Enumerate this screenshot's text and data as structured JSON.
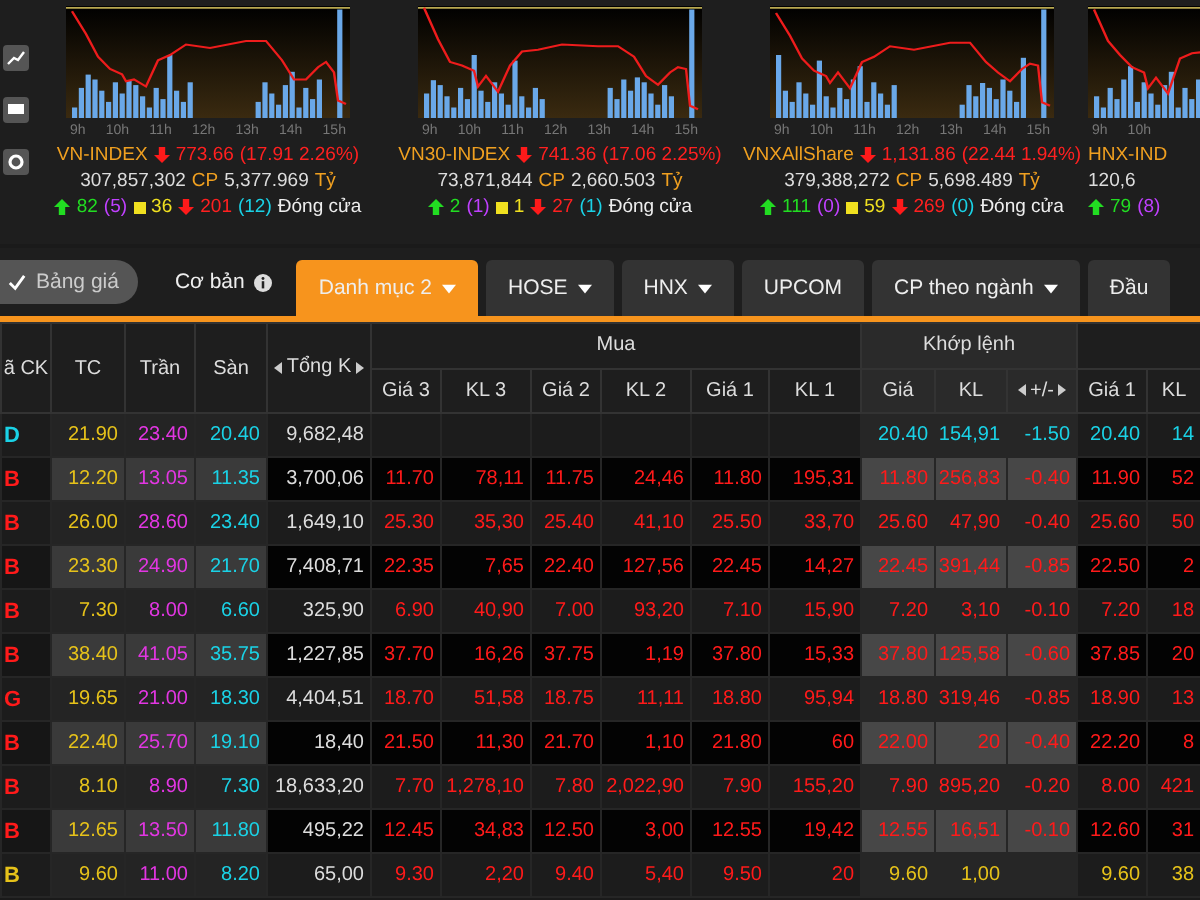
{
  "indices": [
    {
      "name": "VN-INDEX",
      "falling": true,
      "value": "773.66",
      "change": "(17.91 2.26%)",
      "volume": "307,857,302",
      "volume_unit": "CP",
      "value_traded": "5,377.969",
      "value_unit": "Tỷ",
      "advances": "82",
      "ceiling_count": "(5)",
      "unchanged": "36",
      "declines": "201",
      "floor_count": "(12)",
      "session": "Đóng cửa",
      "time_labels": [
        "9h",
        "10h",
        "11h",
        "12h",
        "13h",
        "14h",
        "15h"
      ]
    },
    {
      "name": "VN30-INDEX",
      "falling": true,
      "value": "741.36",
      "change": "(17.06 2.25%)",
      "volume": "73,871,844",
      "volume_unit": "CP",
      "value_traded": "2,660.503",
      "value_unit": "Tỷ",
      "advances": "2",
      "ceiling_count": "(1)",
      "unchanged": "1",
      "declines": "27",
      "floor_count": "(1)",
      "session": "Đóng cửa",
      "time_labels": [
        "9h",
        "10h",
        "11h",
        "12h",
        "13h",
        "14h",
        "15h"
      ]
    },
    {
      "name": "VNXAllShare",
      "falling": true,
      "value": "1,131.86",
      "change": "(22.44 1.94%)",
      "volume": "379,388,272",
      "volume_unit": "CP",
      "value_traded": "5,698.489",
      "value_unit": "Tỷ",
      "advances": "111",
      "ceiling_count": "(0)",
      "unchanged": "59",
      "declines": "269",
      "floor_count": "(0)",
      "session": "Đóng cửa",
      "time_labels": [
        "9h",
        "10h",
        "11h",
        "12h",
        "13h",
        "14h",
        "15h"
      ]
    },
    {
      "name": "HNX-IND",
      "volume": "120,6",
      "advances": "79",
      "ceiling_count": "(8)",
      "time_labels": [
        "9h",
        "10h"
      ]
    }
  ],
  "view_toggle": {
    "label": "Bảng giá",
    "on": true
  },
  "basic_link": {
    "label": "Cơ bản"
  },
  "tabs": [
    {
      "label": "Danh mục 2",
      "dropdown": true,
      "selected": true
    },
    {
      "label": "HOSE",
      "dropdown": true,
      "selected": false
    },
    {
      "label": "HNX",
      "dropdown": true,
      "selected": false
    },
    {
      "label": "UPCOM",
      "dropdown": false,
      "selected": false
    },
    {
      "label": "CP theo ngành",
      "dropdown": true,
      "selected": false
    },
    {
      "label": "Đầu",
      "dropdown": false,
      "selected": false
    }
  ],
  "table": {
    "columns": {
      "symbol": "ã CK",
      "ref": "TC",
      "ceil": "Trần",
      "floor": "Sàn",
      "total": "Tổng K",
      "bid_group": "Mua",
      "match_group": "Khớp lệnh",
      "bid": [
        "Giá 3",
        "KL 3",
        "Giá 2",
        "KL 2",
        "Giá 1",
        "KL 1"
      ],
      "match": [
        "Giá",
        "KL",
        "+/-"
      ],
      "ask": [
        "Giá 1",
        "KL"
      ]
    },
    "rows": [
      {
        "symbol": "D",
        "color": "#1ad2e6",
        "ref": "21.90",
        "ceil": "23.40",
        "floor": "20.40",
        "total": "9,682,48",
        "match": [
          "20.40",
          "154,91",
          "-1.50"
        ],
        "ask": [
          "20.40",
          "14"
        ]
      },
      {
        "symbol": "B",
        "color": "#ff1a1a",
        "ref": "12.20",
        "ceil": "13.05",
        "floor": "11.35",
        "total": "3,700,06",
        "bids": {
          "color": "#ff1a1a",
          "values": [
            "11.70",
            "78,11",
            "11.75",
            "24,46",
            "11.80",
            "195,31"
          ]
        },
        "match": [
          "11.80",
          "256,83",
          "-0.40"
        ],
        "ask": [
          "11.90",
          "52"
        ]
      },
      {
        "symbol": "B",
        "color": "#ff1a1a",
        "ref": "26.00",
        "ceil": "28.60",
        "floor": "23.40",
        "total": "1,649,10",
        "bids": {
          "color": "#ff1a1a",
          "values": [
            "25.30",
            "35,30",
            "25.40",
            "41,10",
            "25.50",
            "33,70"
          ]
        },
        "match": [
          "25.60",
          "47,90",
          "-0.40"
        ],
        "ask": [
          "25.60",
          "50"
        ]
      },
      {
        "symbol": "B",
        "color": "#ff1a1a",
        "ref": "23.30",
        "ceil": "24.90",
        "floor": "21.70",
        "total": "7,408,71",
        "bids": {
          "color": "#ff1a1a",
          "values": [
            "22.35",
            "7,65",
            "22.40",
            "127,56",
            "22.45",
            "14,27"
          ]
        },
        "match": [
          "22.45",
          "391,44",
          "-0.85"
        ],
        "ask": [
          "22.50",
          "2"
        ]
      },
      {
        "symbol": "B",
        "color": "#ff1a1a",
        "ref": "7.30",
        "ceil": "8.00",
        "floor": "6.60",
        "total": "325,90",
        "bids": {
          "color": "#ff1a1a",
          "values": [
            "6.90",
            "40,90",
            "7.00",
            "93,20",
            "7.10",
            "15,90"
          ]
        },
        "match": [
          "7.20",
          "3,10",
          "-0.10"
        ],
        "ask": [
          "7.20",
          "18"
        ]
      },
      {
        "symbol": "B",
        "color": "#ff1a1a",
        "ref": "38.40",
        "ceil": "41.05",
        "floor": "35.75",
        "total": "1,227,85",
        "bids": {
          "color": "#ff1a1a",
          "values": [
            "37.70",
            "16,26",
            "37.75",
            "1,19",
            "37.80",
            "15,33"
          ]
        },
        "match": [
          "37.80",
          "125,58",
          "-0.60"
        ],
        "ask": [
          "37.85",
          "20"
        ]
      },
      {
        "symbol": "G",
        "color": "#ff1a1a",
        "ref": "19.65",
        "ceil": "21.00",
        "floor": "18.30",
        "total": "4,404,51",
        "bids": {
          "color": "#ff1a1a",
          "values": [
            "18.70",
            "51,58",
            "18.75",
            "11,11",
            "18.80",
            "95,94"
          ]
        },
        "match": [
          "18.80",
          "319,46",
          "-0.85"
        ],
        "ask": [
          "18.90",
          "13"
        ]
      },
      {
        "symbol": "B",
        "color": "#ff1a1a",
        "ref": "22.40",
        "ceil": "25.70",
        "floor": "19.10",
        "total": "18,40",
        "bids": {
          "color": "#ff1a1a",
          "values": [
            "21.50",
            "11,30",
            "21.70",
            "1,10",
            "21.80",
            "60"
          ]
        },
        "match": [
          "22.00",
          "20",
          "-0.40"
        ],
        "ask": [
          "22.20",
          "8"
        ]
      },
      {
        "symbol": "B",
        "color": "#ff1a1a",
        "ref": "8.10",
        "ceil": "8.90",
        "floor": "7.30",
        "total": "18,633,20",
        "bids": {
          "color": "#ff1a1a",
          "values": [
            "7.70",
            "1,278,10",
            "7.80",
            "2,022,90",
            "7.90",
            "155,20"
          ]
        },
        "match": [
          "7.90",
          "895,20",
          "-0.20"
        ],
        "ask": [
          "8.00",
          "421"
        ]
      },
      {
        "symbol": "B",
        "color": "#ff1a1a",
        "ref": "12.65",
        "ceil": "13.50",
        "floor": "11.80",
        "total": "495,22",
        "bids": {
          "color": "#ff1a1a",
          "values": [
            "12.45",
            "34,83",
            "12.50",
            "3,00",
            "12.55",
            "19,42"
          ]
        },
        "match": [
          "12.55",
          "16,51",
          "-0.10"
        ],
        "ask": [
          "12.60",
          "31"
        ]
      },
      {
        "symbol": "B",
        "color": "#e6c21a",
        "ref": "9.60",
        "ceil": "11.00",
        "floor": "8.20",
        "total": "65,00",
        "bids": {
          "color": "#ff1a1a",
          "values": [
            "9.30",
            "2,20",
            "9.40",
            "5,40",
            "9.50",
            "20"
          ]
        },
        "match": [
          "9.60",
          "1,00"
        ],
        "ask": [
          "9.60",
          "38"
        ]
      }
    ]
  }
}
